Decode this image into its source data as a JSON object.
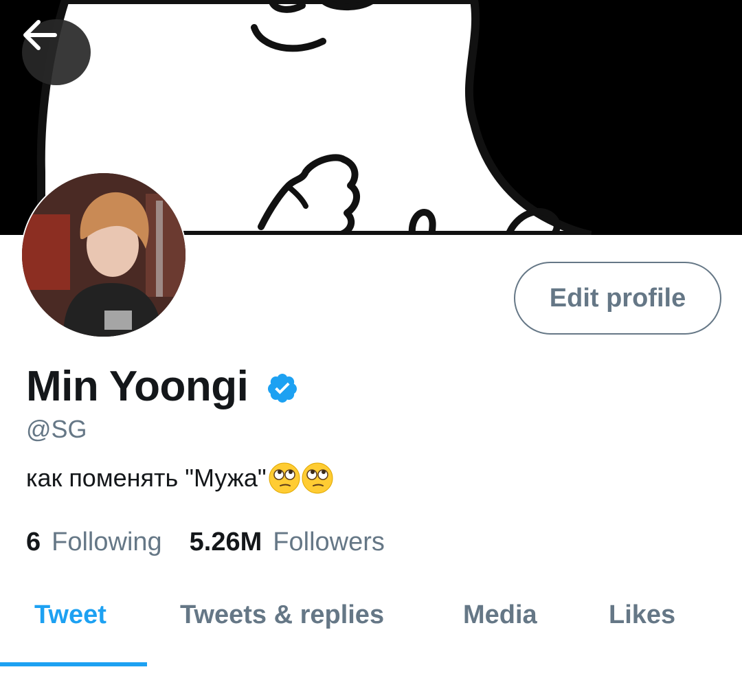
{
  "header": {
    "back_icon": "arrow-left-icon"
  },
  "profile": {
    "name": "Min Yoongi",
    "verified_icon": "verified-badge-icon",
    "handle": "@SG",
    "bio_text": "как поменять \"Мужа\"",
    "bio_emojis": [
      "face-with-rolling-eyes",
      "face-with-rolling-eyes"
    ],
    "edit_button_label": "Edit profile",
    "following_count": "6",
    "following_label": "Following",
    "followers_count": "5.26M",
    "followers_label": "Followers"
  },
  "tabs": [
    {
      "label": "Tweet",
      "active": true
    },
    {
      "label": "Tweets & replies",
      "active": false
    },
    {
      "label": "Media",
      "active": false
    },
    {
      "label": "Likes",
      "active": false
    }
  ],
  "colors": {
    "accent": "#1da1f2",
    "secondary_text": "#657786",
    "primary_text": "#14171a"
  }
}
